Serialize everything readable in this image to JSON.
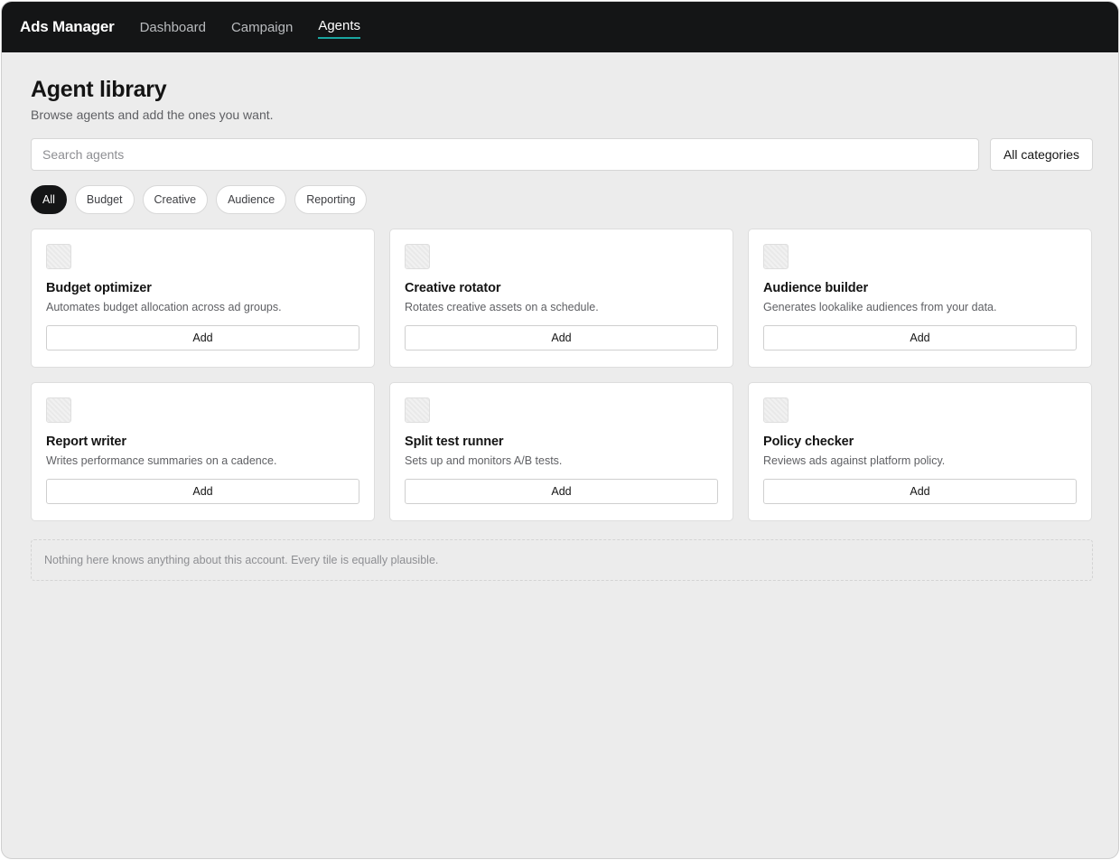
{
  "app": {
    "brand": "Ads Manager",
    "nav": [
      {
        "label": "Dashboard",
        "active": false
      },
      {
        "label": "Campaign",
        "active": false
      },
      {
        "label": "Agents",
        "active": true
      }
    ]
  },
  "page": {
    "title": "Agent library",
    "subtitle": "Browse agents and add the ones you want."
  },
  "search": {
    "placeholder": "Search agents",
    "value": "",
    "category_selected": "All categories"
  },
  "filters": [
    {
      "label": "All",
      "active": true
    },
    {
      "label": "Budget",
      "active": false
    },
    {
      "label": "Creative",
      "active": false
    },
    {
      "label": "Audience",
      "active": false
    },
    {
      "label": "Reporting",
      "active": false
    }
  ],
  "agents": [
    {
      "title": "Budget optimizer",
      "description": "Automates budget allocation across ad groups.",
      "action": "Add",
      "icon": "agent-placeholder-icon"
    },
    {
      "title": "Creative rotator",
      "description": "Rotates creative assets on a schedule.",
      "action": "Add",
      "icon": "agent-placeholder-icon"
    },
    {
      "title": "Audience builder",
      "description": "Generates lookalike audiences from your data.",
      "action": "Add",
      "icon": "agent-placeholder-icon"
    },
    {
      "title": "Report writer",
      "description": "Writes performance summaries on a cadence.",
      "action": "Add",
      "icon": "agent-placeholder-icon"
    },
    {
      "title": "Split test runner",
      "description": "Sets up and monitors A/B tests.",
      "action": "Add",
      "icon": "agent-placeholder-icon"
    },
    {
      "title": "Policy checker",
      "description": "Reviews ads against platform policy.",
      "action": "Add",
      "icon": "agent-placeholder-icon"
    }
  ],
  "notice": "Nothing here knows anything about this account. Every tile is equally plausible.",
  "colors": {
    "topbar": "#141516",
    "accent": "#1aa6a0",
    "background": "#ececec"
  }
}
